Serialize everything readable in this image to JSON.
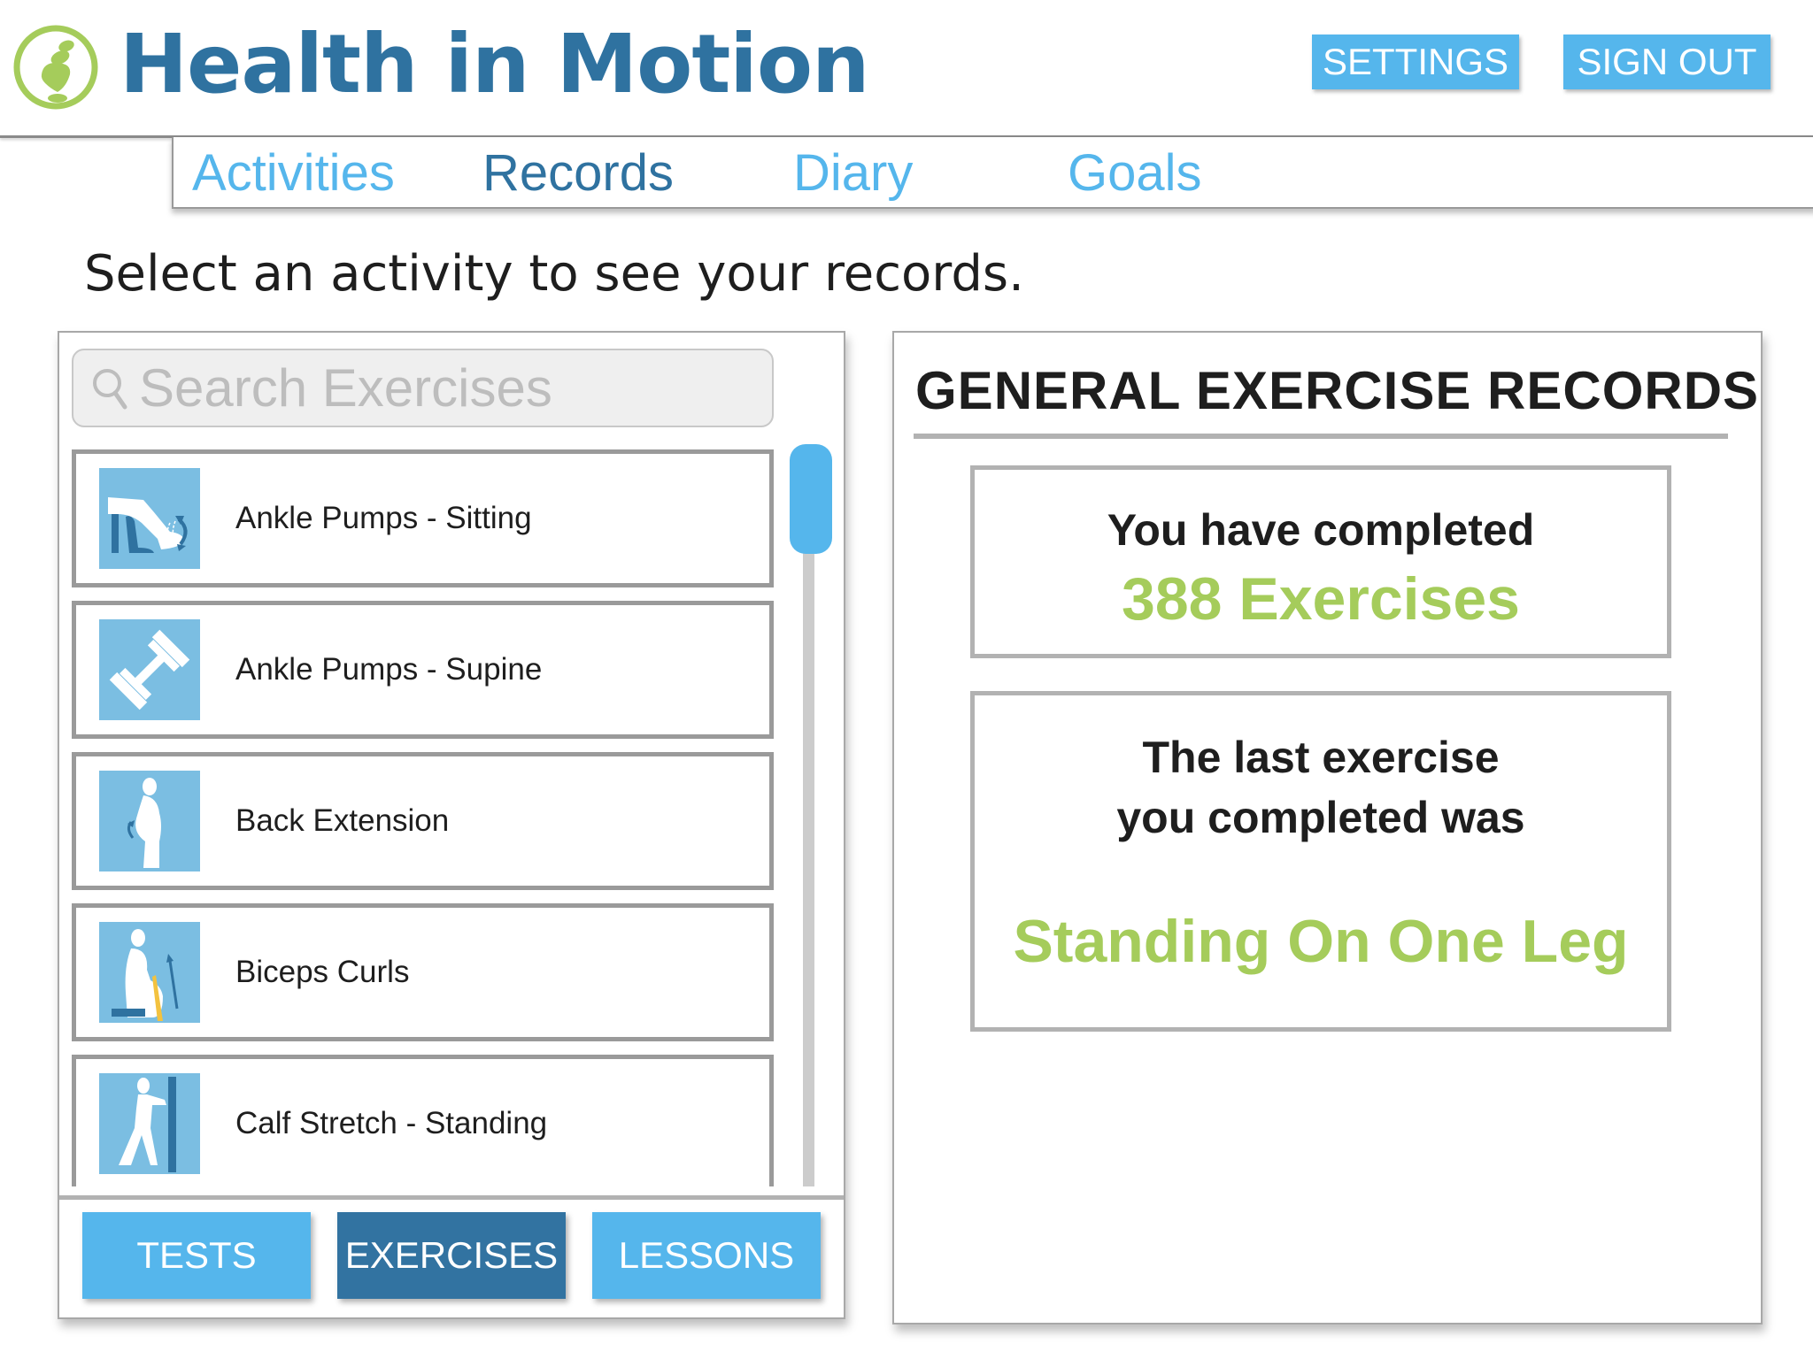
{
  "app": {
    "title": "Health in Motion",
    "logo_icon": "balanced-stones-logo"
  },
  "header": {
    "settings_label": "SETTINGS",
    "signout_label": "SIGN OUT"
  },
  "nav": {
    "items": [
      {
        "label": "Activities",
        "active": false
      },
      {
        "label": "Records",
        "active": true
      },
      {
        "label": "Diary",
        "active": false
      },
      {
        "label": "Goals",
        "active": false
      }
    ]
  },
  "prompt": "Select an activity to see your records.",
  "search": {
    "placeholder": "Search Exercises",
    "value": "",
    "icon": "search-icon"
  },
  "exercises": [
    {
      "label": "Ankle Pumps - Sitting",
      "icon": "ankle-pump-sitting-icon"
    },
    {
      "label": "Ankle Pumps - Supine",
      "icon": "dumbbell-icon"
    },
    {
      "label": "Back Extension",
      "icon": "back-extension-icon"
    },
    {
      "label": "Biceps Curls",
      "icon": "biceps-curl-icon"
    },
    {
      "label": "Calf Stretch - Standing",
      "icon": "calf-stretch-icon"
    }
  ],
  "scroll": {
    "position_fraction": 0.0
  },
  "categories": [
    {
      "label": "TESTS",
      "active": false
    },
    {
      "label": "EXERCISES",
      "active": true
    },
    {
      "label": "LESSONS",
      "active": false
    }
  ],
  "records": {
    "title": "GENERAL EXERCISE RECORDS",
    "completed_label": "You have completed",
    "completed_value": "388 Exercises",
    "last_label": "The last exercise you completed was",
    "last_value": "Standing On One Leg"
  },
  "colors": {
    "brand_blue": "#2f72a0",
    "accent_blue": "#55b6ec",
    "accent_green": "#a5cc5b",
    "thumb_bg": "#7bbee2"
  }
}
